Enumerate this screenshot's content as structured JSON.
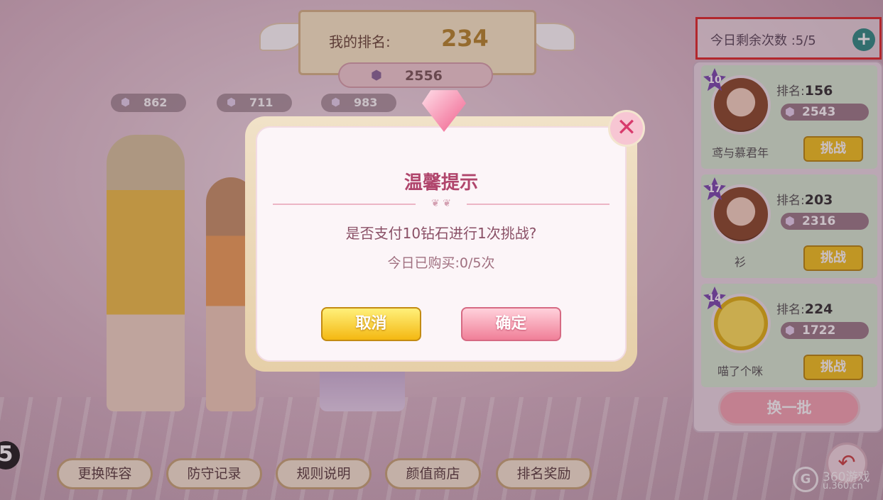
{
  "top": {
    "rank_label": "我的排名:",
    "rank_value": "234",
    "my_power": "2556",
    "others_power": [
      "862",
      "711",
      "983"
    ]
  },
  "remaining": {
    "label": "今日剩余次数 :5/5",
    "plus_icon": "plus-icon"
  },
  "opponents": [
    {
      "level": "10",
      "rank_label": "排名:",
      "rank": "156",
      "power": "2543",
      "name": "鸢与慕君年",
      "challenge": "挑战",
      "avatar": "girl-avatar"
    },
    {
      "level": "17",
      "rank_label": "排名:",
      "rank": "203",
      "power": "2316",
      "name": "衫",
      "challenge": "挑战",
      "avatar": "girl-avatar"
    },
    {
      "level": "14",
      "rank_label": "排名:",
      "rank": "224",
      "power": "1722",
      "name": "喵了个咪",
      "challenge": "挑战",
      "avatar": "smiley-avatar"
    }
  ],
  "swap_button": "换一批",
  "bottom_buttons": [
    "更换阵容",
    "防守记录",
    "规则说明",
    "颜值商店",
    "排名奖励"
  ],
  "badge_5": "5",
  "watermark": {
    "line1": "360游戏",
    "line2": "u.360.cn",
    "logo": "G"
  },
  "dialog": {
    "title": "温馨提示",
    "message": "是否支付10钻石进行1次挑战?",
    "sub_message": "今日已购买:0/5次",
    "cancel": "取消",
    "confirm": "确定",
    "close_glyph": "✕"
  },
  "icons": {
    "gem": "⬢",
    "back": "↶",
    "ornament": "❦ ❦"
  }
}
